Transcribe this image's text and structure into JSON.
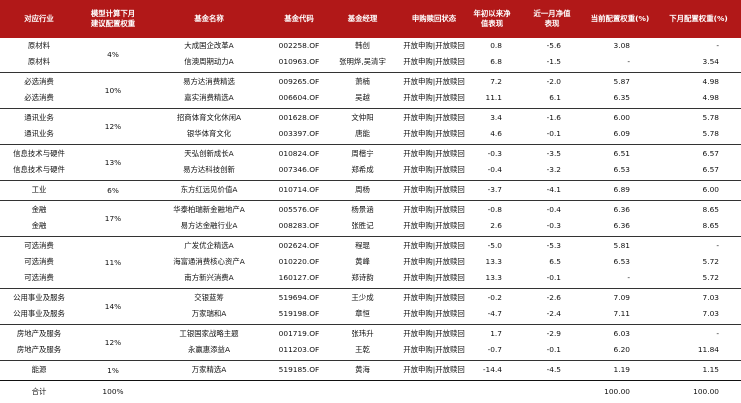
{
  "headers": {
    "industry": "对应行业",
    "weight_suggest": "模型计算下月\n建议配置权重",
    "fund_name": "基金名称",
    "fund_code": "基金代码",
    "manager": "基金经理",
    "status": "申购赎回状态",
    "ytd": "年初以来净\n值表现",
    "m1": "近一月净值\n表现",
    "cur_weight": "当前配置权重(%)",
    "next_weight": "下月配置权重(%)"
  },
  "groups": [
    {
      "weight": "4%",
      "rows": [
        {
          "industry": "原材料",
          "fund": "大成国企改革A",
          "code": "002258.OF",
          "manager": "韩创",
          "status": "开放申购|开放赎回",
          "ytd": "0.8",
          "m1": "-5.6",
          "cur": "3.08",
          "next": "-"
        },
        {
          "industry": "原材料",
          "fund": "信澳周期动力A",
          "code": "010963.OF",
          "manager": "张明烨,吴清宇",
          "status": "开放申购|开放赎回",
          "ytd": "6.8",
          "m1": "-1.5",
          "cur": "-",
          "next": "3.54"
        }
      ]
    },
    {
      "weight": "10%",
      "rows": [
        {
          "industry": "必选消费",
          "fund": "易方达消费精选",
          "code": "009265.OF",
          "manager": "萧楠",
          "status": "开放申购|开放赎回",
          "ytd": "7.2",
          "m1": "-2.0",
          "cur": "5.87",
          "next": "4.98"
        },
        {
          "industry": "必选消费",
          "fund": "嘉实消费精选A",
          "code": "006604.OF",
          "manager": "吴越",
          "status": "开放申购|开放赎回",
          "ytd": "11.1",
          "m1": "6.1",
          "cur": "6.35",
          "next": "4.98"
        }
      ]
    },
    {
      "weight": "12%",
      "rows": [
        {
          "industry": "通讯业务",
          "fund": "招商体育文化休闲A",
          "code": "001628.OF",
          "manager": "文仲阳",
          "status": "开放申购|开放赎回",
          "ytd": "3.4",
          "m1": "-1.6",
          "cur": "6.00",
          "next": "5.78"
        },
        {
          "industry": "通讯业务",
          "fund": "银华体育文化",
          "code": "003397.OF",
          "manager": "唐能",
          "status": "开放申购|开放赎回",
          "ytd": "4.6",
          "m1": "-0.1",
          "cur": "6.09",
          "next": "5.78"
        }
      ]
    },
    {
      "weight": "13%",
      "rows": [
        {
          "industry": "信息技术与硬件",
          "fund": "天弘创新成长A",
          "code": "010824.OF",
          "manager": "周楷宁",
          "status": "开放申购|开放赎回",
          "ytd": "-0.3",
          "m1": "-3.5",
          "cur": "6.51",
          "next": "6.57"
        },
        {
          "industry": "信息技术与硬件",
          "fund": "易方达科技创新",
          "code": "007346.OF",
          "manager": "郑希成",
          "status": "开放申购|开放赎回",
          "ytd": "-0.4",
          "m1": "-3.2",
          "cur": "6.53",
          "next": "6.57"
        }
      ]
    },
    {
      "weight": "6%",
      "rows": [
        {
          "industry": "工业",
          "fund": "东方红远见价值A",
          "code": "010714.OF",
          "manager": "周杨",
          "status": "开放申购|开放赎回",
          "ytd": "-3.7",
          "m1": "-4.1",
          "cur": "6.89",
          "next": "6.00"
        }
      ]
    },
    {
      "weight": "17%",
      "rows": [
        {
          "industry": "金融",
          "fund": "华泰柏瑞新金融地产A",
          "code": "005576.OF",
          "manager": "杨景涵",
          "status": "开放申购|开放赎回",
          "ytd": "-0.8",
          "m1": "-0.4",
          "cur": "6.36",
          "next": "8.65"
        },
        {
          "industry": "金融",
          "fund": "易方达金融行业A",
          "code": "008283.OF",
          "manager": "张胜记",
          "status": "开放申购|开放赎回",
          "ytd": "2.6",
          "m1": "-0.3",
          "cur": "6.36",
          "next": "8.65"
        }
      ]
    },
    {
      "weight": "11%",
      "rows": [
        {
          "industry": "可选消费",
          "fund": "广发优企精选A",
          "code": "002624.OF",
          "manager": "程琨",
          "status": "开放申购|开放赎回",
          "ytd": "-5.0",
          "m1": "-5.3",
          "cur": "5.81",
          "next": "-"
        },
        {
          "industry": "可选消费",
          "fund": "海富通消费核心资产A",
          "code": "010220.OF",
          "manager": "黄峰",
          "status": "开放申购|开放赎回",
          "ytd": "13.3",
          "m1": "6.5",
          "cur": "6.53",
          "next": "5.72"
        },
        {
          "industry": "可选消费",
          "fund": "南方新兴消费A",
          "code": "160127.OF",
          "manager": "郑诗韵",
          "status": "开放申购|开放赎回",
          "ytd": "13.3",
          "m1": "-0.1",
          "cur": "-",
          "next": "5.72"
        }
      ]
    },
    {
      "weight": "14%",
      "rows": [
        {
          "industry": "公用事业及服务",
          "fund": "交银蓝筹",
          "code": "519694.OF",
          "manager": "王少成",
          "status": "开放申购|开放赎回",
          "ytd": "-0.2",
          "m1": "-2.6",
          "cur": "7.09",
          "next": "7.03"
        },
        {
          "industry": "公用事业及服务",
          "fund": "万家瑞和A",
          "code": "519198.OF",
          "manager": "章恒",
          "status": "开放申购|开放赎回",
          "ytd": "-4.7",
          "m1": "-2.4",
          "cur": "7.11",
          "next": "7.03"
        }
      ]
    },
    {
      "weight": "12%",
      "rows": [
        {
          "industry": "房地产及服务",
          "fund": "工银国家战略主题",
          "code": "001719.OF",
          "manager": "张玮升",
          "status": "开放申购|开放赎回",
          "ytd": "1.7",
          "m1": "-2.9",
          "cur": "6.03",
          "next": "-"
        },
        {
          "industry": "房地产及服务",
          "fund": "永赢惠添益A",
          "code": "011203.OF",
          "manager": "王乾",
          "status": "开放申购|开放赎回",
          "ytd": "-0.7",
          "m1": "-0.1",
          "cur": "6.20",
          "next": "11.84"
        }
      ]
    },
    {
      "weight": "1%",
      "rows": [
        {
          "industry": "能源",
          "fund": "万家精选A",
          "code": "519185.OF",
          "manager": "黄海",
          "status": "开放申购|开放赎回",
          "ytd": "-14.4",
          "m1": "-4.5",
          "cur": "1.19",
          "next": "1.15"
        }
      ]
    }
  ],
  "total": {
    "label": "合计",
    "weight": "100%",
    "cur": "100.00",
    "next": "100.00"
  }
}
